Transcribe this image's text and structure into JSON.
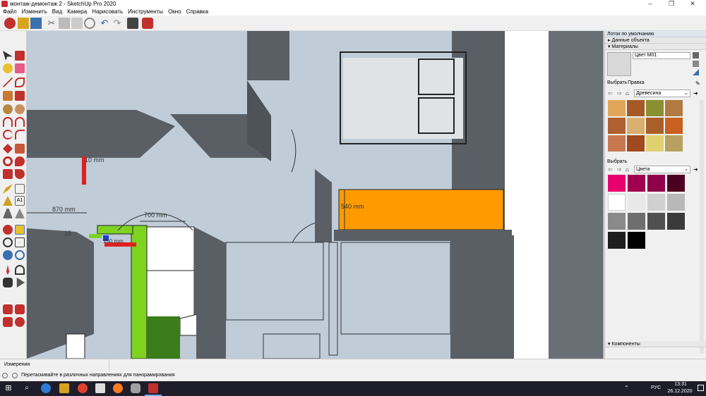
{
  "window": {
    "title": "монтаж-демонтаж 2 - SketchUp Pro 2020"
  },
  "menu": [
    "Файл",
    "Изменить",
    "Вид",
    "Камера",
    "Нарисовать",
    "Инструменты",
    "Окно",
    "Справка"
  ],
  "viewport": {
    "dimensions": {
      "d870": "870 mm",
      "d700": "700 mm",
      "d540": "540 mm",
      "d10": "10 mm",
      "d15": "15",
      "d150": "150 mm"
    },
    "colors": {
      "floor": "#c0ccd8",
      "wall": "#5a5f66",
      "cabinet": "#ff9a00",
      "pipe": "#7ed321"
    }
  },
  "tray": {
    "title": "Лоток по умолчанию",
    "entity_info": "Данные объекта",
    "materials": "Материалы",
    "material_name": "Цвет M01",
    "tab_select": "Выбрать",
    "tab_edit": "Правка",
    "category1": "Древесина",
    "select2": "Выбрать",
    "category2": "Цвета",
    "components": "Компоненты",
    "wood_swatches": [
      "#e2a65a",
      "#a55a26",
      "#8a9030",
      "#b07a40",
      "#b06030",
      "#d8b070",
      "#a86028",
      "#c86020",
      "#c87850",
      "#a04820",
      "#e0d070",
      "#b8a060"
    ],
    "color_swatches": [
      "#e8006e",
      "#a00050",
      "#90004a",
      "#4a0020",
      "#ffffff",
      "#e8e8e8",
      "#d0d0d0",
      "#b8b8b8",
      "#8a8a8a",
      "#6e6e6e",
      "#505050",
      "#3a3a3a",
      "#1e1e1e",
      "#000000"
    ]
  },
  "status": {
    "measure_label": "Измерения",
    "hint": "Перетаскивайте в различных направлениях для панорамирования"
  },
  "taskbar": {
    "lang": "РУС",
    "time": "13:31",
    "date": "26.12.2020"
  }
}
